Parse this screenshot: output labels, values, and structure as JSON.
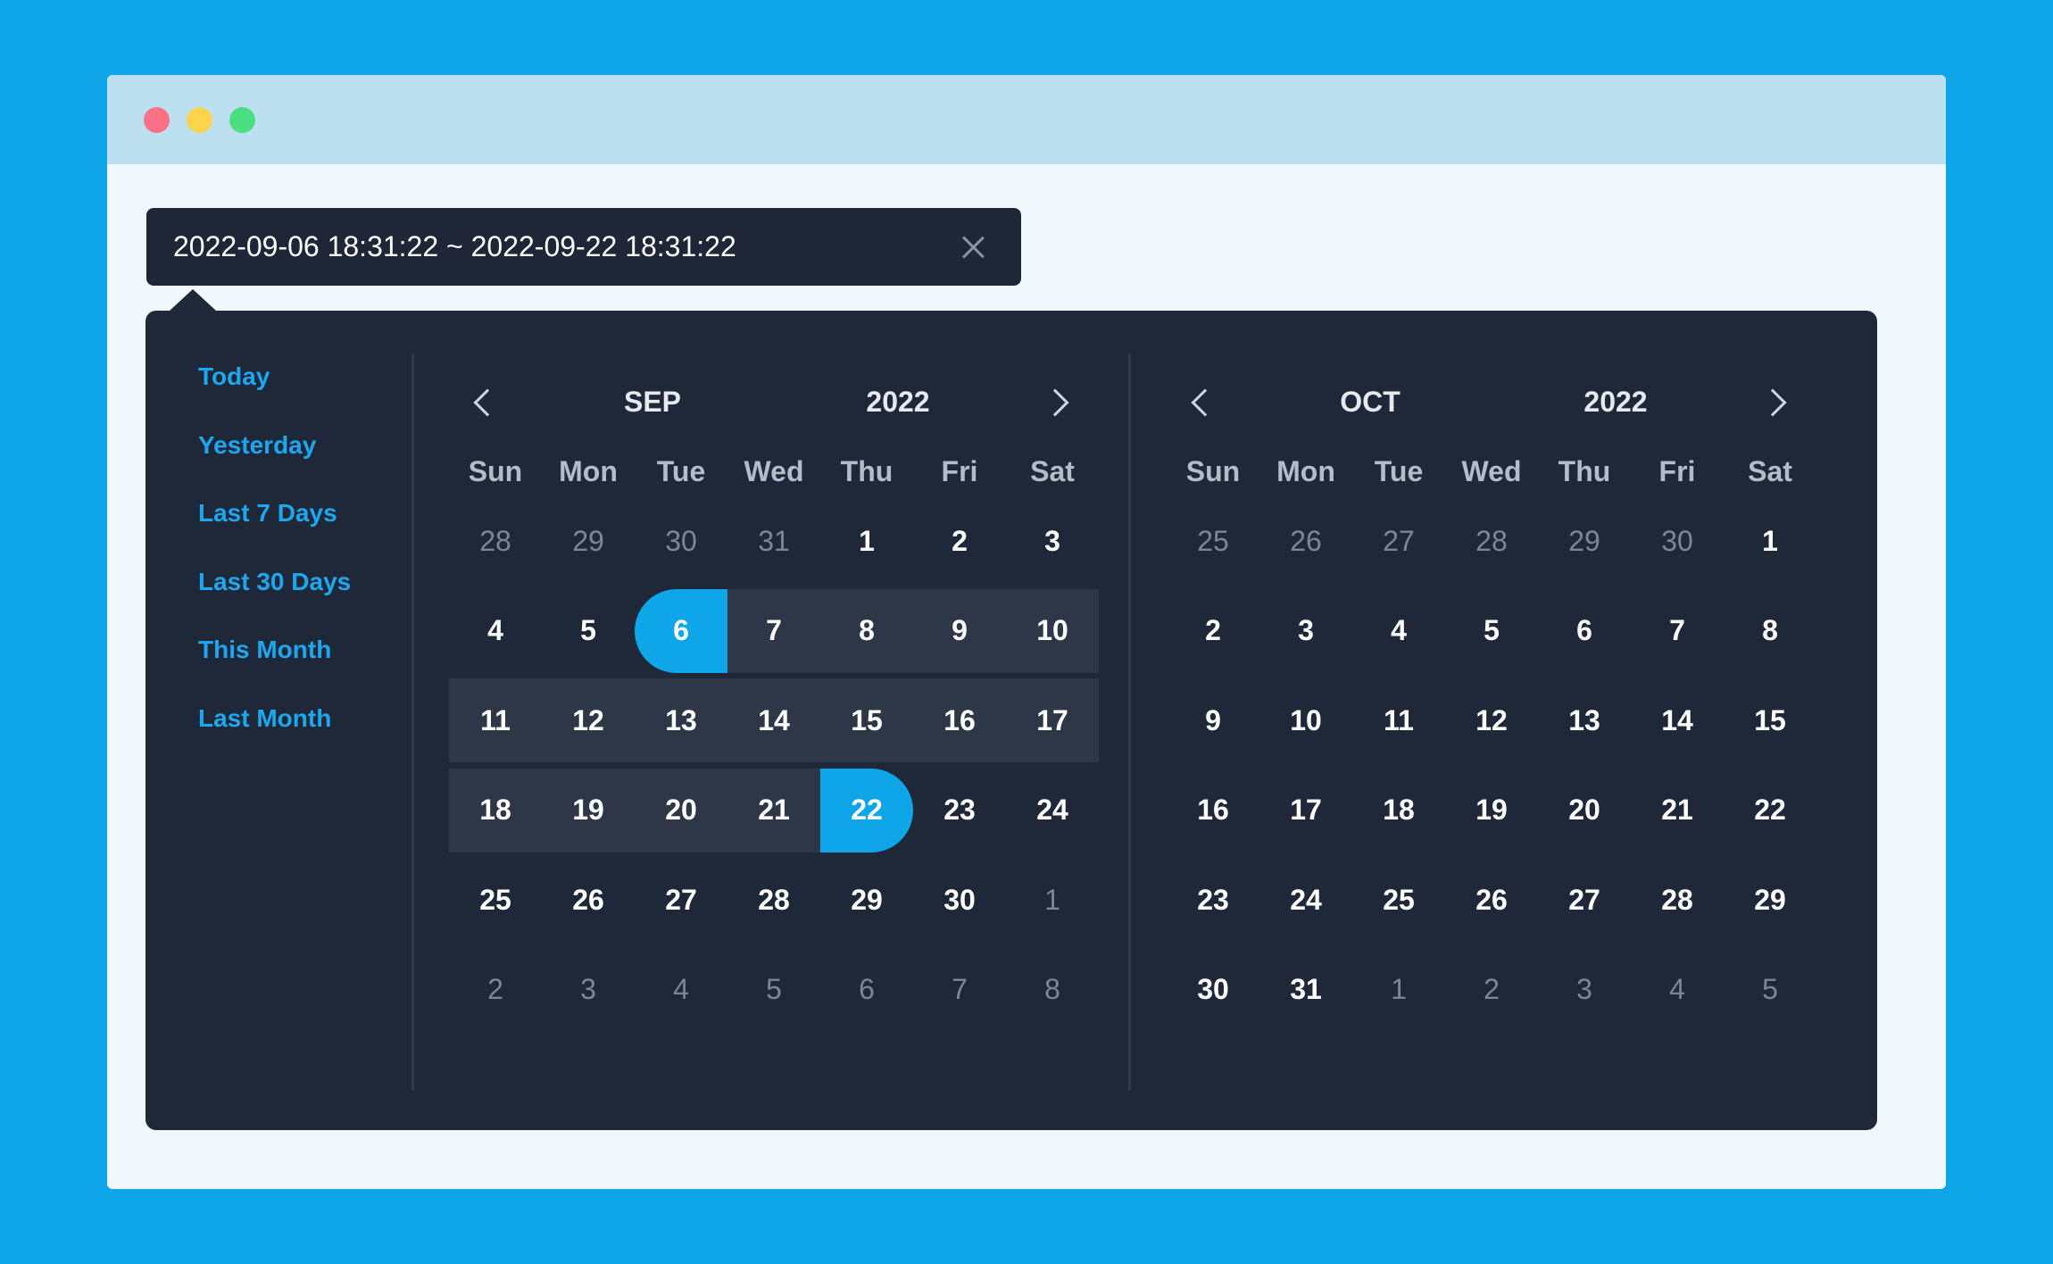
{
  "window": {
    "controls": [
      "close",
      "minimize",
      "maximize"
    ],
    "colors": {
      "close": "#fb7185",
      "minimize": "#fcd34d",
      "maximize": "#4ade80"
    }
  },
  "input": {
    "value": "2022-09-06 18:31:22 ~ 2022-09-22 18:31:22",
    "clear_icon": "close-icon"
  },
  "shortcuts": [
    "Today",
    "Yesterday",
    "Last 7 Days",
    "Last 30 Days",
    "This Month",
    "Last Month"
  ],
  "accent_color": "#0ea5e9",
  "calendars": [
    {
      "month": "SEP",
      "year": "2022",
      "weekdays": [
        "Sun",
        "Mon",
        "Tue",
        "Wed",
        "Thu",
        "Fri",
        "Sat"
      ],
      "weeks": [
        [
          {
            "d": "28",
            "m": true
          },
          {
            "d": "29",
            "m": true
          },
          {
            "d": "30",
            "m": true
          },
          {
            "d": "31",
            "m": true
          },
          {
            "d": "1"
          },
          {
            "d": "2"
          },
          {
            "d": "3"
          }
        ],
        [
          {
            "d": "4"
          },
          {
            "d": "5"
          },
          {
            "d": "6",
            "s": "start"
          },
          {
            "d": "7",
            "s": "in"
          },
          {
            "d": "8",
            "s": "in"
          },
          {
            "d": "9",
            "s": "in"
          },
          {
            "d": "10",
            "s": "in"
          }
        ],
        [
          {
            "d": "11",
            "s": "in"
          },
          {
            "d": "12",
            "s": "in"
          },
          {
            "d": "13",
            "s": "in"
          },
          {
            "d": "14",
            "s": "in"
          },
          {
            "d": "15",
            "s": "in"
          },
          {
            "d": "16",
            "s": "in"
          },
          {
            "d": "17",
            "s": "in"
          }
        ],
        [
          {
            "d": "18",
            "s": "in"
          },
          {
            "d": "19",
            "s": "in"
          },
          {
            "d": "20",
            "s": "in"
          },
          {
            "d": "21",
            "s": "in"
          },
          {
            "d": "22",
            "s": "end"
          },
          {
            "d": "23"
          },
          {
            "d": "24"
          }
        ],
        [
          {
            "d": "25"
          },
          {
            "d": "26"
          },
          {
            "d": "27"
          },
          {
            "d": "28"
          },
          {
            "d": "29"
          },
          {
            "d": "30"
          },
          {
            "d": "1",
            "m": true
          }
        ],
        [
          {
            "d": "2",
            "m": true
          },
          {
            "d": "3",
            "m": true
          },
          {
            "d": "4",
            "m": true
          },
          {
            "d": "5",
            "m": true
          },
          {
            "d": "6",
            "m": true
          },
          {
            "d": "7",
            "m": true
          },
          {
            "d": "8",
            "m": true
          }
        ]
      ]
    },
    {
      "month": "OCT",
      "year": "2022",
      "weekdays": [
        "Sun",
        "Mon",
        "Tue",
        "Wed",
        "Thu",
        "Fri",
        "Sat"
      ],
      "weeks": [
        [
          {
            "d": "25",
            "m": true
          },
          {
            "d": "26",
            "m": true
          },
          {
            "d": "27",
            "m": true
          },
          {
            "d": "28",
            "m": true
          },
          {
            "d": "29",
            "m": true
          },
          {
            "d": "30",
            "m": true
          },
          {
            "d": "1"
          }
        ],
        [
          {
            "d": "2"
          },
          {
            "d": "3"
          },
          {
            "d": "4"
          },
          {
            "d": "5"
          },
          {
            "d": "6"
          },
          {
            "d": "7"
          },
          {
            "d": "8"
          }
        ],
        [
          {
            "d": "9"
          },
          {
            "d": "10"
          },
          {
            "d": "11"
          },
          {
            "d": "12"
          },
          {
            "d": "13"
          },
          {
            "d": "14"
          },
          {
            "d": "15"
          }
        ],
        [
          {
            "d": "16"
          },
          {
            "d": "17"
          },
          {
            "d": "18"
          },
          {
            "d": "19"
          },
          {
            "d": "20"
          },
          {
            "d": "21"
          },
          {
            "d": "22"
          }
        ],
        [
          {
            "d": "23"
          },
          {
            "d": "24"
          },
          {
            "d": "25"
          },
          {
            "d": "26"
          },
          {
            "d": "27"
          },
          {
            "d": "28"
          },
          {
            "d": "29"
          }
        ],
        [
          {
            "d": "30"
          },
          {
            "d": "31"
          },
          {
            "d": "1",
            "m": true
          },
          {
            "d": "2",
            "m": true
          },
          {
            "d": "3",
            "m": true
          },
          {
            "d": "4",
            "m": true
          },
          {
            "d": "5",
            "m": true
          }
        ]
      ]
    }
  ]
}
